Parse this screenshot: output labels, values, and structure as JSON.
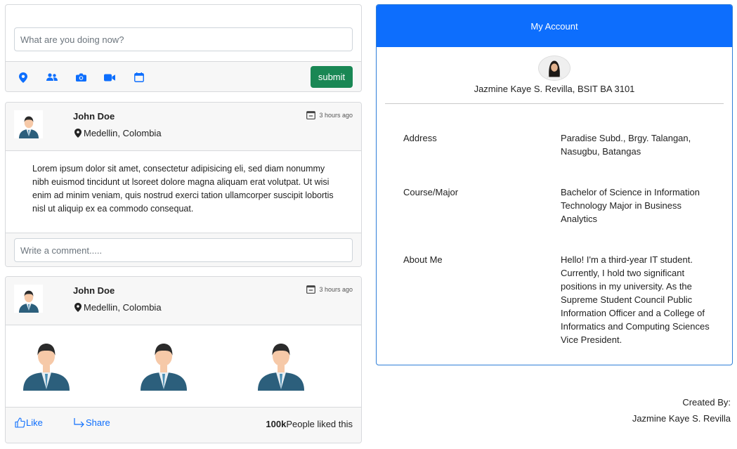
{
  "composer": {
    "placeholder": "What are you doing now?",
    "submit_label": "submit",
    "tools": [
      "location-icon",
      "people-icon",
      "camera-icon",
      "video-icon",
      "calendar-icon"
    ]
  },
  "posts": [
    {
      "author": "John Doe",
      "location": "Medellin, Colombia",
      "time": "3 hours ago",
      "body": "Lorem ipsum dolor sit amet, consectetur adipisicing eli, sed diam nonummy nibh euismod tincidunt ut lsoreet dolore magna aliquam erat volutpat. Ut wisi enim ad minim veniam, quis nostrud exerci tation ullamcorper suscipit lobortis nisl ut aliquip ex ea commodo consequat.",
      "comment_placeholder": "Write a comment....."
    },
    {
      "author": "John Doe",
      "location": "Medellin, Colombia",
      "time": "3 hours ago",
      "like_label": "Like",
      "share_label": "Share",
      "likes_count": "100k",
      "likes_text": "People liked this"
    }
  ],
  "account": {
    "title": "My Account",
    "name": "Jazmine Kaye S. Revilla, BSIT BA 3101",
    "rows": [
      {
        "label": "Address",
        "value": "Paradise Subd., Brgy. Talangan, Nasugbu, Batangas"
      },
      {
        "label": "Course/Major",
        "value": "Bachelor of Science in Information Technology Major in Business Analytics"
      },
      {
        "label": "About Me",
        "value": "Hello! I'm a third-year IT student. Currently, I hold two significant positions in my university. As the Supreme Student Council Public Information Officer and a College of Informatics and Computing Sciences Vice President."
      }
    ]
  },
  "footer": {
    "created_by_label": "Created By:",
    "created_by_name": "Jazmine Kaye S. Revilla"
  },
  "colors": {
    "primary": "#0d6efd",
    "success": "#198754",
    "header_bg": "#f7f7f7",
    "suit": "#2c5f7c"
  }
}
